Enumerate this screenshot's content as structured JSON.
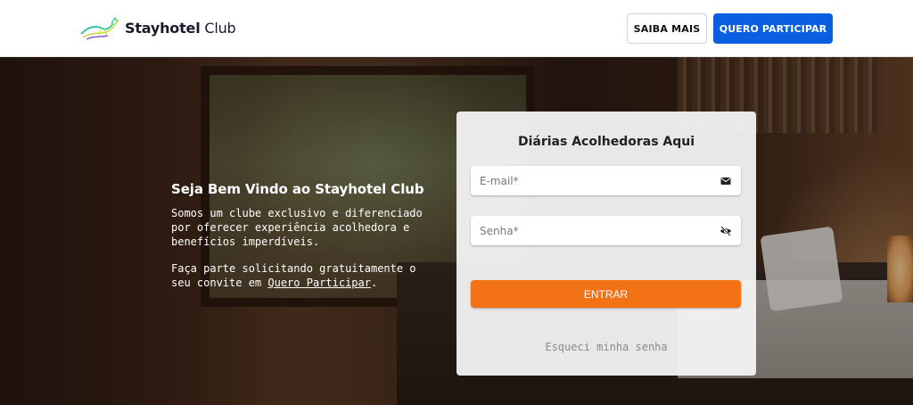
{
  "header": {
    "logo": {
      "brand": "Stayhotel",
      "suffix": "Club"
    },
    "saiba_mais_label": "SAIBA MAIS",
    "quero_participar_label": "QUERO PARTICIPAR",
    "colors": {
      "primary_button": "#0a5fe0"
    }
  },
  "welcome": {
    "title": "Seja Bem Vindo ao Stayhotel Club",
    "paragraph1": "Somos um clube exclusivo e diferenciado por oferecer experiência acolhedora e benefícios imperdíveis.",
    "paragraph2_before": "Faça parte solicitando gratuitamente o seu convite em ",
    "paragraph2_link": "Quero Participar",
    "paragraph2_after": "."
  },
  "login": {
    "title": "Diárias Acolhedoras Aqui",
    "email_placeholder": "E-mail*",
    "email_icon": "mail-icon",
    "password_placeholder": "Senha*",
    "password_icon": "eye-off-icon",
    "submit_label": "ENTRAR",
    "forgot_label": "Esqueci minha senha",
    "colors": {
      "submit_button": "#f47216"
    }
  }
}
